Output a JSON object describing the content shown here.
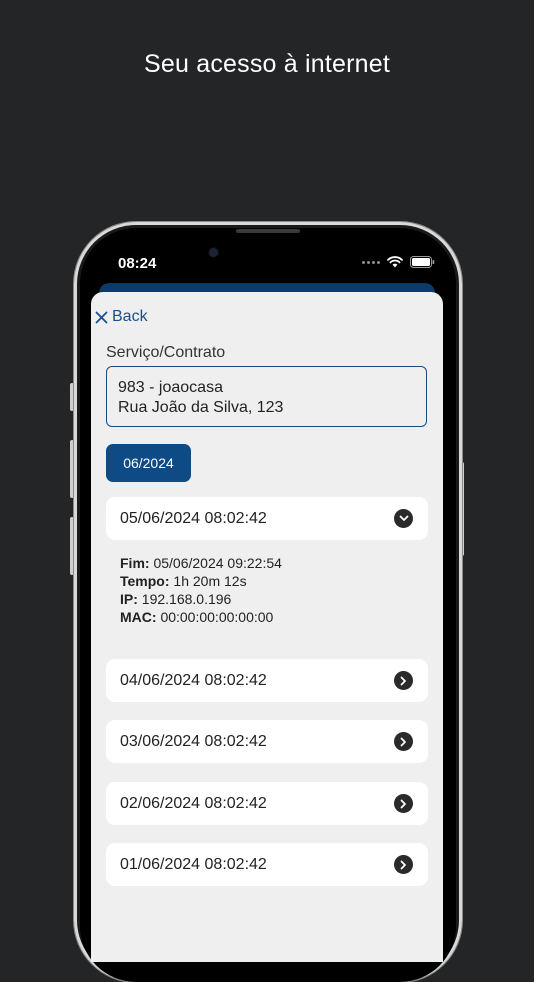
{
  "headline": "Seu acesso à internet",
  "status_bar": {
    "time": "08:24"
  },
  "nav": {
    "back_label": "Back"
  },
  "contract": {
    "label": "Serviço/Contrato",
    "line1": "983 - joaocasa",
    "line2": "Rua João da Silva, 123"
  },
  "month_filter": {
    "selected": "06/2024"
  },
  "sessions": [
    {
      "start": "05/06/2024 08:02:42",
      "expanded": true,
      "details": {
        "end_label": "Fim:",
        "end_value": "05/06/2024 09:22:54",
        "duration_label": "Tempo:",
        "duration_value": "1h 20m 12s",
        "ip_label": "IP:",
        "ip_value": "192.168.0.196",
        "mac_label": "MAC:",
        "mac_value": "00:00:00:00:00:00"
      }
    },
    {
      "start": "04/06/2024 08:02:42",
      "expanded": false
    },
    {
      "start": "03/06/2024 08:02:42",
      "expanded": false
    },
    {
      "start": "02/06/2024 08:02:42",
      "expanded": false
    },
    {
      "start": "01/06/2024 08:02:42",
      "expanded": false
    }
  ],
  "icons": {
    "close": "close-icon",
    "expanded": "chevron-down-icon",
    "collapsed": "chevron-right-icon"
  },
  "colors": {
    "background": "#232527",
    "primary": "#0e4a84",
    "sheet": "#efefef",
    "card": "#ffffff"
  }
}
